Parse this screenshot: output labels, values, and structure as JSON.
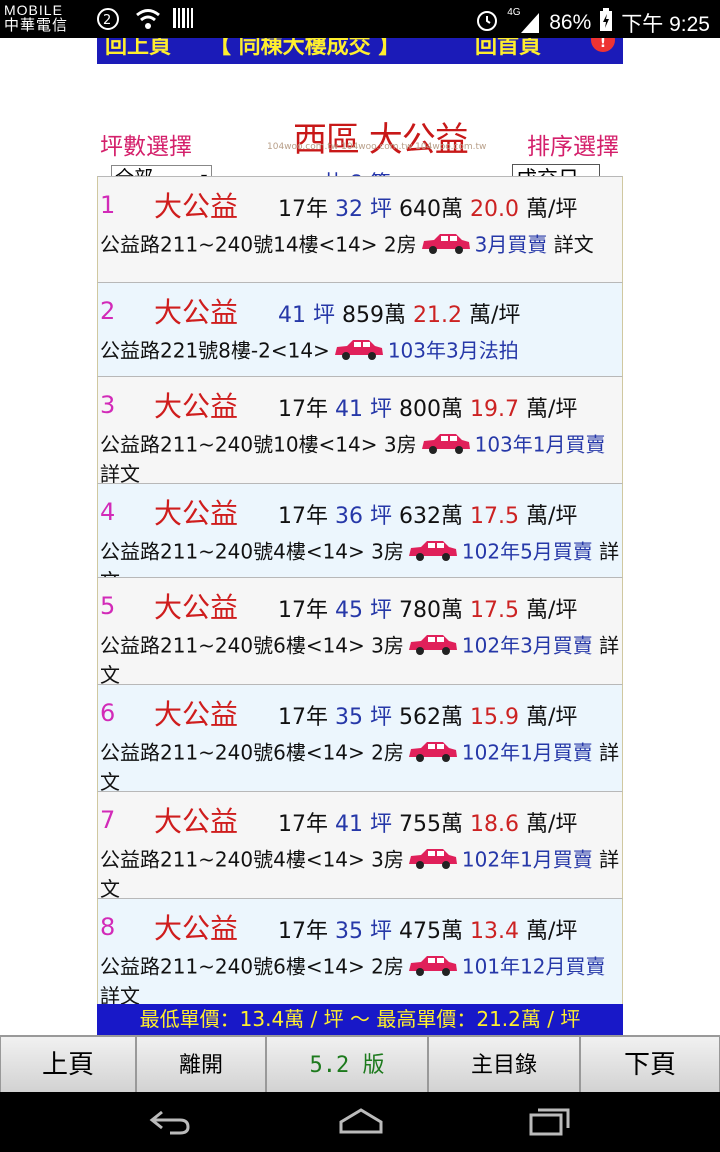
{
  "status": {
    "carrier_line1": "MOBILE",
    "carrier_line2": "中華電信",
    "network": "4G",
    "battery": "86%",
    "time": "下午 9:25"
  },
  "top_nav": {
    "prev": "回上頁",
    "title": "【 同棟大樓成交 】",
    "home": "回首頁"
  },
  "header": {
    "size_label": "坪數選擇",
    "sort_label": "排序選擇",
    "region": "西區  大公益",
    "watermark": "104woo.com.tw  104woo.com.tw  104woo.com.tw",
    "size_select": "全部",
    "sort_select": "成交日",
    "count": "共 8 筆"
  },
  "listings": [
    {
      "no": "1",
      "name": "大公益",
      "age": "17年",
      "size": "32 坪",
      "price": "640萬",
      "unit": "20.0",
      "per": "萬/坪",
      "addr": "公益路211~240號14樓<14> 2房",
      "date": "3月買賣",
      "detail": "詳文"
    },
    {
      "no": "2",
      "name": "大公益",
      "age": "",
      "size": "41 坪",
      "price": "859萬",
      "unit": "21.2",
      "per": "萬/坪",
      "addr": "公益路221號8樓-2<14>",
      "date": "103年3月法拍",
      "detail": ""
    },
    {
      "no": "3",
      "name": "大公益",
      "age": "17年",
      "size": "41 坪",
      "price": "800萬",
      "unit": "19.7",
      "per": "萬/坪",
      "addr": "公益路211~240號10樓<14> 3房",
      "date": "103年1月買賣",
      "detail": "詳文"
    },
    {
      "no": "4",
      "name": "大公益",
      "age": "17年",
      "size": "36 坪",
      "price": "632萬",
      "unit": "17.5",
      "per": "萬/坪",
      "addr": "公益路211~240號4樓<14> 3房",
      "date": "102年5月買賣",
      "detail": "詳文"
    },
    {
      "no": "5",
      "name": "大公益",
      "age": "17年",
      "size": "45 坪",
      "price": "780萬",
      "unit": "17.5",
      "per": "萬/坪",
      "addr": "公益路211~240號6樓<14> 3房",
      "date": "102年3月買賣",
      "detail": "詳文"
    },
    {
      "no": "6",
      "name": "大公益",
      "age": "17年",
      "size": "35 坪",
      "price": "562萬",
      "unit": "15.9",
      "per": "萬/坪",
      "addr": "公益路211~240號6樓<14> 2房",
      "date": "102年1月買賣",
      "detail": "詳文"
    },
    {
      "no": "7",
      "name": "大公益",
      "age": "17年",
      "size": "41 坪",
      "price": "755萬",
      "unit": "18.6",
      "per": "萬/坪",
      "addr": "公益路211~240號4樓<14> 3房",
      "date": "102年1月買賣",
      "detail": "詳文"
    },
    {
      "no": "8",
      "name": "大公益",
      "age": "17年",
      "size": "35 坪",
      "price": "475萬",
      "unit": "13.4",
      "per": "萬/坪",
      "addr": "公益路211~240號6樓<14> 2房",
      "date": "101年12月買賣",
      "detail": "詳文"
    }
  ],
  "summary": "最低單價：13.4萬 / 坪  ～  最高單價：21.2萬 / 坪",
  "bottom_bar": {
    "prev": "上頁",
    "exit": "離開",
    "version": "5.2 版",
    "menu": "主目錄",
    "next": "下頁"
  },
  "colors": {
    "accent_blue": "#1818c8",
    "price_red": "#cc2222",
    "number_magenta": "#d22ab8",
    "car_red": "#e0205a"
  }
}
